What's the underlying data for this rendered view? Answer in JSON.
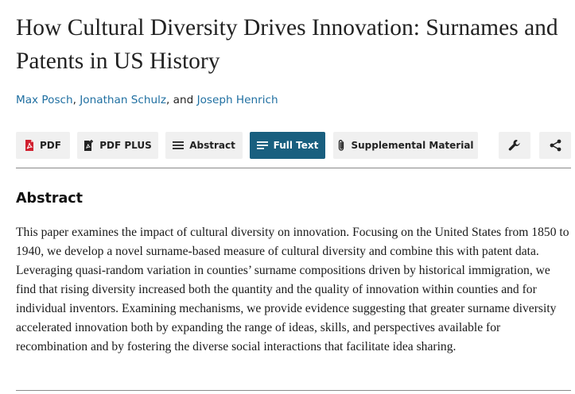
{
  "article": {
    "title": "How Cultural Diversity Drives Innovation: Surnames and Patents in US History",
    "authors": [
      {
        "name": "Max Posch"
      },
      {
        "name": "Jonathan Schulz"
      },
      {
        "name": "Joseph Henrich"
      }
    ],
    "author_separators": [
      ", ",
      ", and "
    ]
  },
  "toolbar": {
    "pdf_label": "PDF",
    "pdf_plus_label": "PDF PLUS",
    "abstract_label": "Abstract",
    "full_text_label": "Full Text",
    "supplemental_label": "Supplemental Material",
    "icons": {
      "pdf": "pdf-icon",
      "pdf_plus": "pdf-plus-icon",
      "abstract": "list-lines-icon",
      "full_text": "list-lines-icon",
      "supplemental": "paperclip-icon",
      "tools": "wrench-icon",
      "share": "share-icon"
    },
    "colors": {
      "active_bg": "#195f7f",
      "button_bg": "#f0f0f0",
      "pdf_red": "#d0202f"
    }
  },
  "abstract": {
    "heading": "Abstract",
    "text": "This paper examines the impact of cultural diversity on innovation. Focusing on the United States from 1850 to 1940, we develop a novel surname-based measure of cultural diversity and combine this with patent data. Leveraging quasi-random variation in counties’ surname compositions driven by historical immigration, we find that rising diversity increased both the quantity and the quality of innovation within counties and for individual inventors. Examining mechanisms, we provide evidence suggesting that greater surname diversity accelerated innovation both by expanding the range of ideas, skills, and perspectives available for recombination and by fostering the diverse social interactions that facilitate idea sharing."
  },
  "colors": {
    "link": "#1f6fa1"
  }
}
